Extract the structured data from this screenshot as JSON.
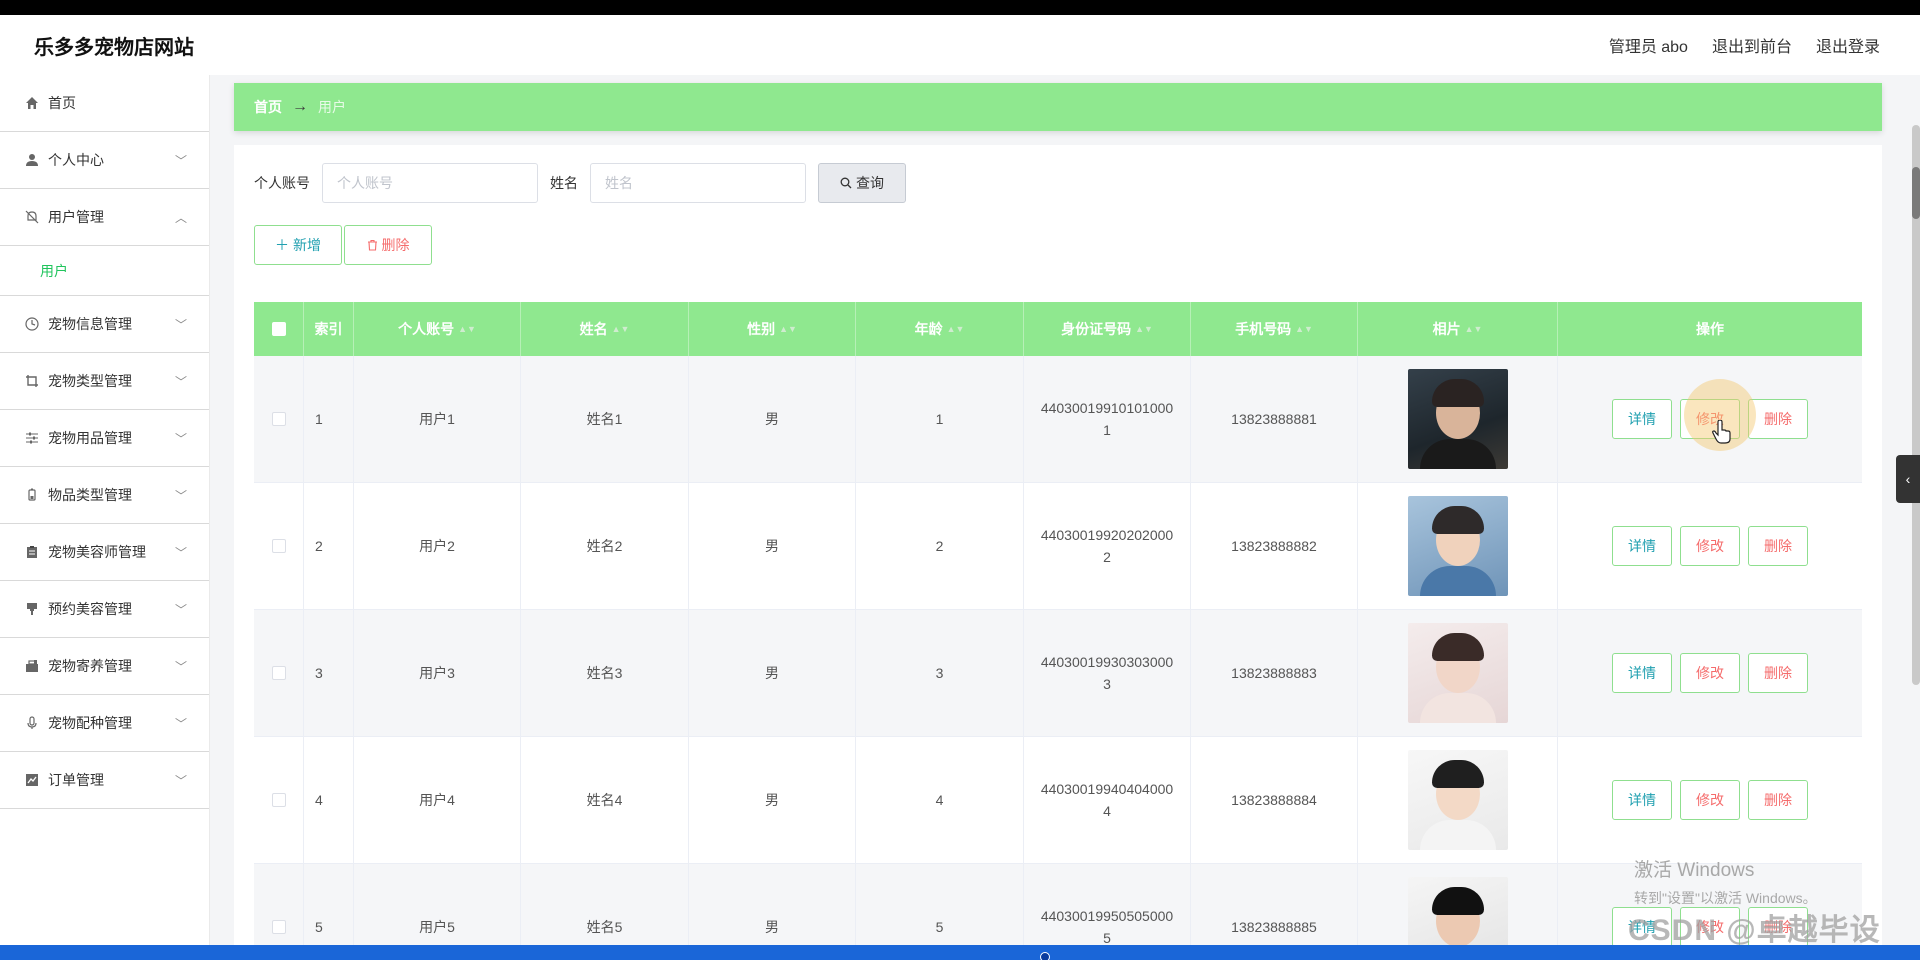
{
  "header": {
    "site_title": "乐多多宠物店网站",
    "admin_label": "管理员 abo",
    "front_link": "退出到前台",
    "logout_link": "退出登录"
  },
  "sidebar": {
    "items": [
      {
        "label": "首页",
        "icon": "home-icon",
        "expandable": false
      },
      {
        "label": "个人中心",
        "icon": "user-icon",
        "expandable": true
      },
      {
        "label": "用户管理",
        "icon": "bell-off-icon",
        "expandable": true,
        "expanded": true,
        "children": [
          "用户"
        ]
      },
      {
        "label": "宠物信息管理",
        "icon": "clock-icon",
        "expandable": true
      },
      {
        "label": "宠物类型管理",
        "icon": "crop-icon",
        "expandable": true
      },
      {
        "label": "宠物用品管理",
        "icon": "sliders-icon",
        "expandable": true
      },
      {
        "label": "物品类型管理",
        "icon": "battery-icon",
        "expandable": true
      },
      {
        "label": "宠物美容师管理",
        "icon": "clipboard-icon",
        "expandable": true
      },
      {
        "label": "预约美容管理",
        "icon": "brush-icon",
        "expandable": true
      },
      {
        "label": "宠物寄养管理",
        "icon": "briefcase-icon",
        "expandable": true
      },
      {
        "label": "宠物配种管理",
        "icon": "microphone-icon",
        "expandable": true
      },
      {
        "label": "订单管理",
        "icon": "chart-icon",
        "expandable": true
      }
    ]
  },
  "breadcrumb": {
    "home": "首页",
    "separator": "→",
    "current": "用户"
  },
  "search": {
    "account_label": "个人账号",
    "account_placeholder": "个人账号",
    "name_label": "姓名",
    "name_placeholder": "姓名",
    "query_button": "查询"
  },
  "actions": {
    "add_button": "新增",
    "delete_button": "删除"
  },
  "table": {
    "columns": [
      "索引",
      "个人账号",
      "姓名",
      "性别",
      "年龄",
      "身份证号码",
      "手机号码",
      "相片",
      "操作"
    ],
    "row_actions": {
      "detail": "详情",
      "edit": "修改",
      "delete": "删除"
    },
    "rows": [
      {
        "index": "1",
        "account": "用户1",
        "name": "姓名1",
        "gender": "男",
        "age": "1",
        "id_card": "440300199101010001",
        "phone": "13823888881"
      },
      {
        "index": "2",
        "account": "用户2",
        "name": "姓名2",
        "gender": "男",
        "age": "2",
        "id_card": "440300199202020002",
        "phone": "13823888882"
      },
      {
        "index": "3",
        "account": "用户3",
        "name": "姓名3",
        "gender": "男",
        "age": "3",
        "id_card": "440300199303030003",
        "phone": "13823888883"
      },
      {
        "index": "4",
        "account": "用户4",
        "name": "姓名4",
        "gender": "男",
        "age": "4",
        "id_card": "440300199404040004",
        "phone": "13823888884"
      },
      {
        "index": "5",
        "account": "用户5",
        "name": "姓名5",
        "gender": "男",
        "age": "5",
        "id_card": "440300199505050005",
        "phone": "13823888885"
      }
    ]
  },
  "overlay": {
    "windows_activate_title": "激活 Windows",
    "windows_activate_sub": "转到\"设置\"以激活 Windows。",
    "watermark": "CSDN @卓越毕设"
  },
  "colors": {
    "accent_green": "#8fe88f",
    "active_menu_text": "#21c45d",
    "danger_text": "#f56c6c",
    "info_text": "#21a0b0"
  }
}
